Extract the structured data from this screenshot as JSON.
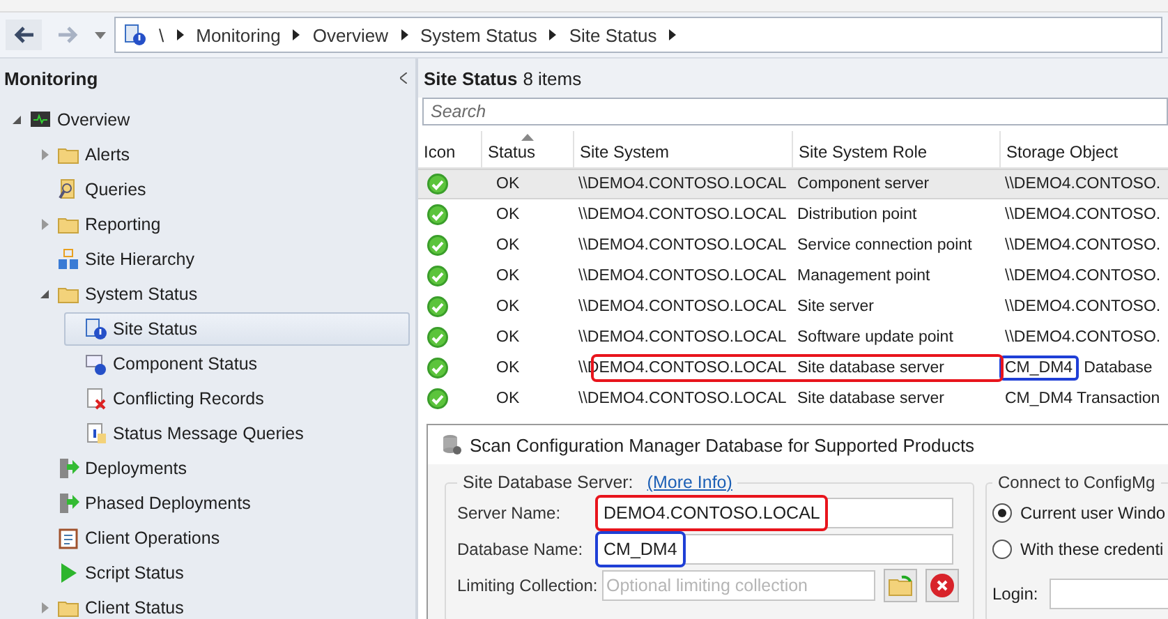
{
  "breadcrumb": {
    "items": [
      "\\",
      "Monitoring",
      "Overview",
      "System Status",
      "Site Status"
    ]
  },
  "nav_pane": {
    "title": "Monitoring",
    "tree": [
      {
        "label": "Overview",
        "kind": "overview",
        "expanded": true,
        "selected": false,
        "children": [
          {
            "label": "Alerts",
            "kind": "folder",
            "expanded": false,
            "selected": false
          },
          {
            "label": "Queries",
            "kind": "queries",
            "selected": false
          },
          {
            "label": "Reporting",
            "kind": "folder",
            "expanded": false,
            "selected": false
          },
          {
            "label": "Site Hierarchy",
            "kind": "hierarchy",
            "selected": false
          },
          {
            "label": "System Status",
            "kind": "folder",
            "expanded": true,
            "selected": false,
            "children": [
              {
                "label": "Site Status",
                "kind": "site-status",
                "selected": true
              },
              {
                "label": "Component Status",
                "kind": "component",
                "selected": false
              },
              {
                "label": "Conflicting Records",
                "kind": "conflict",
                "selected": false
              },
              {
                "label": "Status Message Queries",
                "kind": "info",
                "selected": false
              }
            ]
          },
          {
            "label": "Deployments",
            "kind": "deploy",
            "selected": false
          },
          {
            "label": "Phased Deployments",
            "kind": "deploy",
            "selected": false
          },
          {
            "label": "Client Operations",
            "kind": "clipboard",
            "selected": false
          },
          {
            "label": "Script Status",
            "kind": "play",
            "selected": false
          },
          {
            "label": "Client Status",
            "kind": "folder",
            "expanded": false,
            "selected": false
          }
        ]
      }
    ]
  },
  "list": {
    "title": "Site Status",
    "count": "8 items",
    "search": {
      "placeholder": "Search"
    },
    "columns": [
      {
        "label": "Icon",
        "sorted": false
      },
      {
        "label": "Status",
        "sorted": true
      },
      {
        "label": "Site System",
        "sorted": false
      },
      {
        "label": "Site System Role",
        "sorted": false
      },
      {
        "label": "Storage Object",
        "sorted": false
      }
    ],
    "rows": [
      {
        "selected": true,
        "cells": [
          "",
          "OK",
          "\\\\DEMO4.CONTOSO.LOCAL",
          "Component server",
          "\\\\DEMO4.CONTOSO."
        ]
      },
      {
        "selected": false,
        "cells": [
          "",
          "OK",
          "\\\\DEMO4.CONTOSO.LOCAL",
          "Distribution point",
          "\\\\DEMO4.CONTOSO."
        ]
      },
      {
        "selected": false,
        "cells": [
          "",
          "OK",
          "\\\\DEMO4.CONTOSO.LOCAL",
          "Service connection point",
          "\\\\DEMO4.CONTOSO."
        ]
      },
      {
        "selected": false,
        "cells": [
          "",
          "OK",
          "\\\\DEMO4.CONTOSO.LOCAL",
          "Management point",
          "\\\\DEMO4.CONTOSO."
        ]
      },
      {
        "selected": false,
        "cells": [
          "",
          "OK",
          "\\\\DEMO4.CONTOSO.LOCAL",
          "Site server",
          "\\\\DEMO4.CONTOSO."
        ]
      },
      {
        "selected": false,
        "cells": [
          "",
          "OK",
          "\\\\DEMO4.CONTOSO.LOCAL",
          "Software update point",
          "\\\\DEMO4.CONTOSO."
        ]
      },
      {
        "selected": false,
        "cells": [
          "",
          "OK",
          "\\\\DEMO4.CONTOSO.LOCAL",
          "Site database server",
          {
            "parts": [
              {
                "text": "CM_DM4",
                "highlight": {
                  "color": "#1f3fd6"
                }
              },
              {
                "text": "Database"
              }
            ]
          }
        ],
        "highlight": {
          "color": "#e8141c"
        }
      },
      {
        "selected": false,
        "cells": [
          "",
          "OK",
          "\\\\DEMO4.CONTOSO.LOCAL",
          "Site database server",
          "CM_DM4 Transaction"
        ]
      }
    ]
  },
  "dialog": {
    "title": "Scan Configuration Manager Database for Supported Products",
    "server_group": {
      "label": "Site Database Server:",
      "link": "(More Info)",
      "fields": [
        {
          "kind": "text",
          "label": "Server Name:",
          "value": "DEMO4.CONTOSO.LOCAL",
          "highlight": {
            "color": "#e8141c"
          }
        },
        {
          "kind": "text",
          "label": "Database Name:",
          "value": "CM_DM4",
          "highlight": {
            "color": "#1f3fd6"
          }
        },
        {
          "kind": "collection",
          "label": "Limiting Collection:",
          "placeholder": "Optional limiting collection"
        }
      ]
    },
    "connect_group": {
      "label": "Connect to ConfigMg",
      "options": [
        {
          "label": "Current user Windo",
          "selected": true
        },
        {
          "label": "With these credenti",
          "selected": false
        }
      ],
      "login": {
        "label": "Login:"
      }
    }
  }
}
